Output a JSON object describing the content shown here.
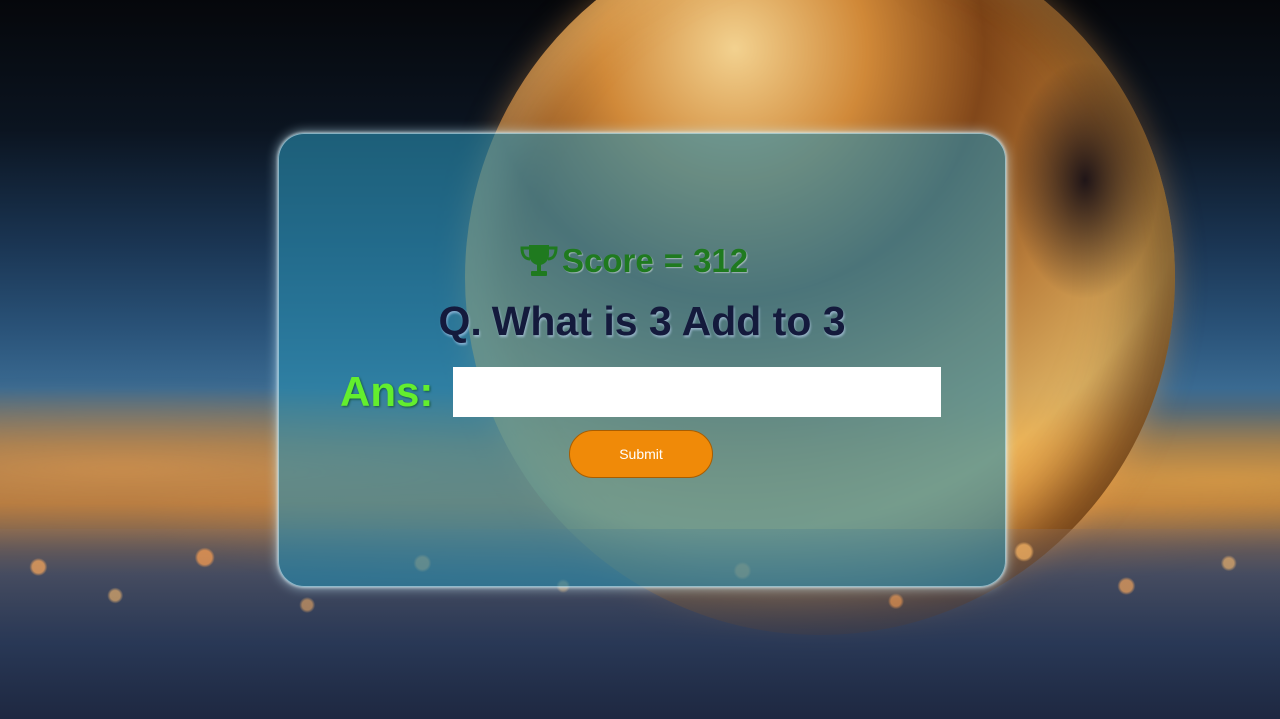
{
  "background": {
    "description_icon": "frozen-bubble-background"
  },
  "quiz": {
    "score_icon": "trophy-icon",
    "score_label": "Score",
    "score_equals": "=",
    "score_value": "312",
    "question_prefix": "Q.",
    "question_text": "What is 3 Add to 3",
    "answer_label": "Ans:",
    "answer_value": "",
    "answer_placeholder": "",
    "submit_label": "Submit"
  },
  "colors": {
    "score": "#1f7a1f",
    "question": "#141a3c",
    "answer_label": "#63ee2e",
    "submit_bg": "#f08a08",
    "card": "rgba(40,140,175,0.62)"
  }
}
